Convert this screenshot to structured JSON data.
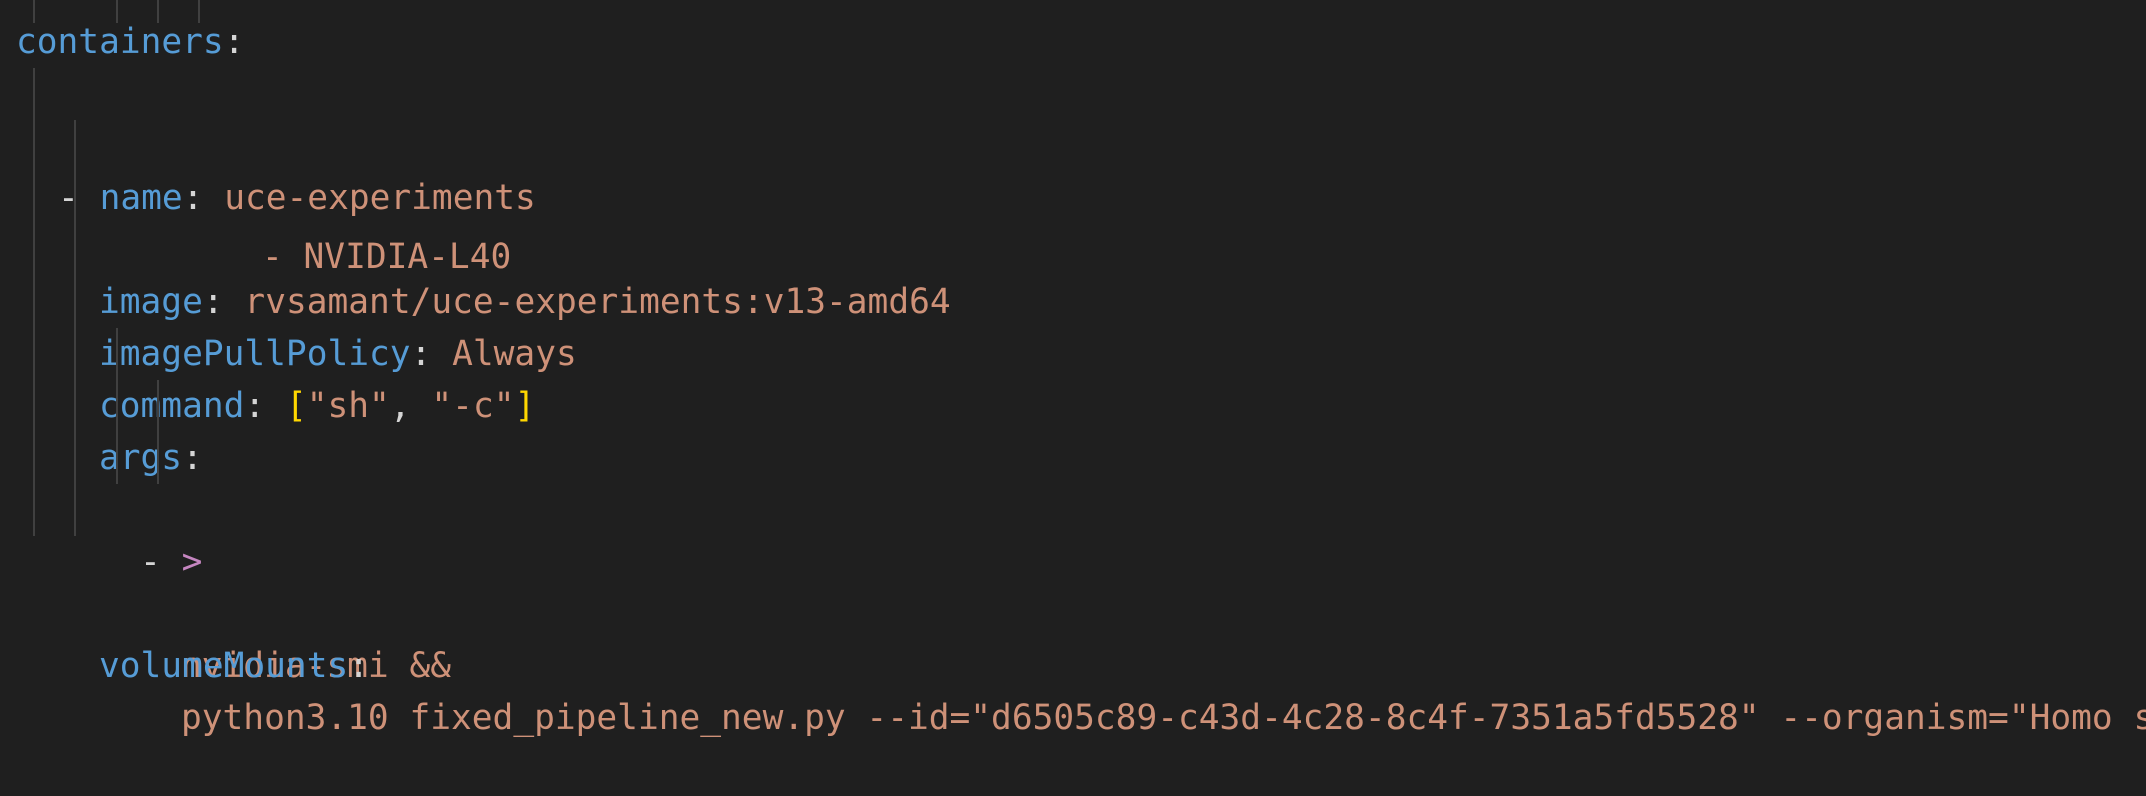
{
  "editor": {
    "language": "yaml",
    "theme": {
      "background": "#1f1f1f",
      "key_color": "#569cd6",
      "string_color": "#ce9178",
      "bracket_color": "#ffd700",
      "indicator_color": "#c586c0",
      "indent_guide_color": "#404040"
    },
    "lines": {
      "l0": {
        "value": "- NVIDIA-L40"
      },
      "l1": {
        "key": "containers",
        "colon": ":"
      },
      "l2": {
        "dash": "-",
        "key": "name",
        "colon": ":",
        "value": "uce-experiments"
      },
      "l3": {
        "key": "image",
        "colon": ":",
        "value": "rvsamant/uce-experiments:v13-amd64"
      },
      "l4": {
        "key": "imagePullPolicy",
        "colon": ":",
        "value": "Always"
      },
      "l5": {
        "key": "command",
        "colon": ":",
        "bracket_open": "[",
        "item1": "\"sh\"",
        "comma": ",",
        "item2": "\"-c\"",
        "bracket_close": "]"
      },
      "l6": {
        "key": "args",
        "colon": ":"
      },
      "l7": {
        "dash": "-",
        "indicator": ">"
      },
      "l8": {
        "value": "nvidia-smi &&"
      },
      "l9": {
        "value": "python3.10 fixed_pipeline_new.py --id=\"d6505c89-c43d-4c28-8c4f-7351a5fd5528\" --organism=\"Homo s"
      },
      "l10": {
        "key": "volumeMounts",
        "colon": ":"
      }
    }
  }
}
